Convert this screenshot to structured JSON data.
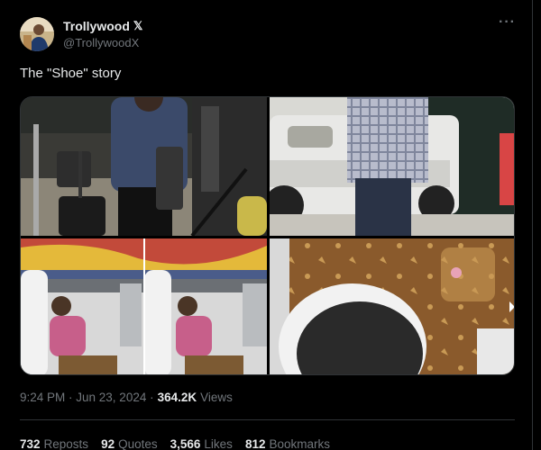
{
  "tweet": {
    "author": {
      "display_name": "Trollywood",
      "badge": "𝕏",
      "handle": "@TrollywoodX"
    },
    "more_icon": "more-horizontal-icon",
    "text": "The \"Shoe\" story",
    "media": [
      {
        "label": "airport-traveler-with-luggage"
      },
      {
        "label": "man-beside-white-suv"
      },
      {
        "label": "woman-seated-with-handbag"
      },
      {
        "label": "shoe-closeup-with-handbag"
      }
    ],
    "timestamp": "9:24 PM · Jun 23, 2024 ·",
    "views_count": "364.2K",
    "views_label": "Views",
    "stats": [
      {
        "count": "732",
        "label": "Reposts"
      },
      {
        "count": "92",
        "label": "Quotes"
      },
      {
        "count": "3,566",
        "label": "Likes"
      },
      {
        "count": "812",
        "label": "Bookmarks"
      }
    ]
  },
  "colors": {
    "background": "#000000",
    "text_primary": "#e7e9ea",
    "text_secondary": "#71767b",
    "border": "#2f3336"
  }
}
